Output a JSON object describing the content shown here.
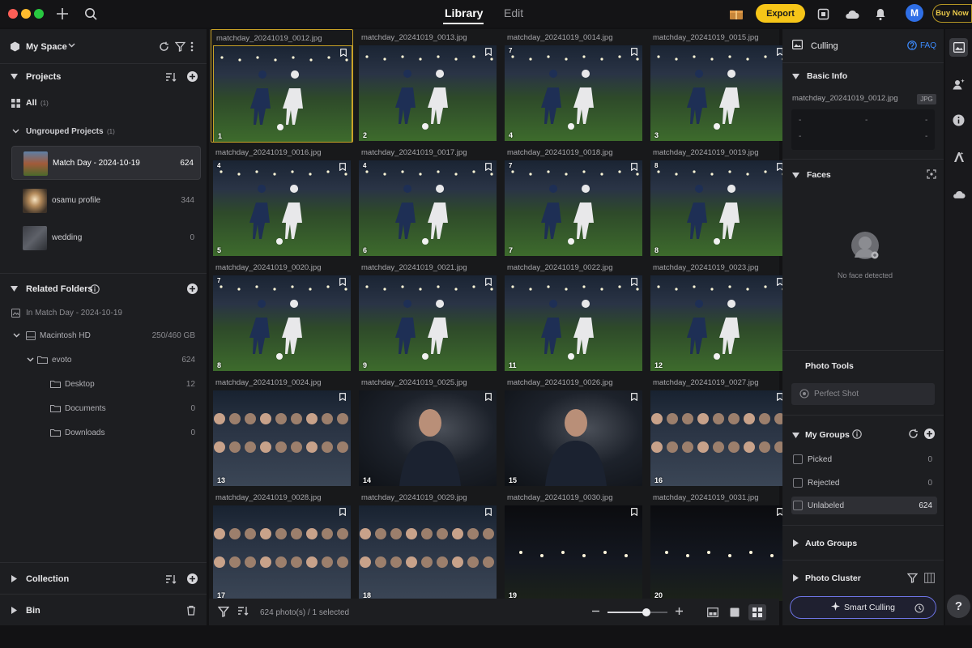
{
  "title_bar": {
    "tabs": [
      {
        "label": "Library",
        "active": true
      },
      {
        "label": "Edit",
        "active": false
      }
    ],
    "export_label": "Export",
    "avatar_initial": "M",
    "buy_label": "Buy Now",
    "accent_yellow": "#f6c518"
  },
  "left_panel": {
    "space_title": "My Space",
    "projects_header": "Projects",
    "all_label": "All",
    "all_count": "(1)",
    "ungrouped_label": "Ungrouped Projects",
    "ungrouped_count": "(1)",
    "projects": [
      {
        "name": "Match Day - 2024-10-19",
        "count": "624",
        "selected": true
      },
      {
        "name": "osamu profile",
        "count": "344",
        "selected": false
      },
      {
        "name": "wedding",
        "count": "0",
        "selected": false
      }
    ],
    "related_folders_header": "Related Folders",
    "in_project_label": "In Match Day - 2024-10-19",
    "drive": {
      "name": "Macintosh HD",
      "usage": "250/460 GB"
    },
    "folders": [
      {
        "name": "evoto",
        "count": "624"
      },
      {
        "name": "Desktop",
        "count": "12"
      },
      {
        "name": "Documents",
        "count": "0"
      },
      {
        "name": "Downloads",
        "count": "0"
      }
    ],
    "collection_label": "Collection",
    "bin_label": "Bin"
  },
  "grid": {
    "photos": [
      {
        "file": "matchday_20241019_0012.jpg",
        "number": "1",
        "rating": "",
        "scene": "stadium"
      },
      {
        "file": "matchday_20241019_0013.jpg",
        "number": "2",
        "rating": "",
        "scene": "stadium"
      },
      {
        "file": "matchday_20241019_0014.jpg",
        "number": "4",
        "rating": "7",
        "scene": "stadium"
      },
      {
        "file": "matchday_20241019_0015.jpg",
        "number": "3",
        "rating": "",
        "scene": "stadium"
      },
      {
        "file": "matchday_20241019_0016.jpg",
        "number": "5",
        "rating": "4",
        "scene": "stadium"
      },
      {
        "file": "matchday_20241019_0017.jpg",
        "number": "6",
        "rating": "4",
        "scene": "stadium"
      },
      {
        "file": "matchday_20241019_0018.jpg",
        "number": "7",
        "rating": "7",
        "scene": "stadium"
      },
      {
        "file": "matchday_20241019_0019.jpg",
        "number": "8",
        "rating": "8",
        "scene": "stadium"
      },
      {
        "file": "matchday_20241019_0020.jpg",
        "number": "8",
        "rating": "7",
        "scene": "stadium"
      },
      {
        "file": "matchday_20241019_0021.jpg",
        "number": "9",
        "rating": "",
        "scene": "stadium"
      },
      {
        "file": "matchday_20241019_0022.jpg",
        "number": "11",
        "rating": "",
        "scene": "stadium"
      },
      {
        "file": "matchday_20241019_0023.jpg",
        "number": "12",
        "rating": "",
        "scene": "stadium"
      },
      {
        "file": "matchday_20241019_0024.jpg",
        "number": "13",
        "rating": "",
        "scene": "crowd"
      },
      {
        "file": "matchday_20241019_0025.jpg",
        "number": "14",
        "rating": "",
        "scene": "portrait"
      },
      {
        "file": "matchday_20241019_0026.jpg",
        "number": "15",
        "rating": "",
        "scene": "portrait"
      },
      {
        "file": "matchday_20241019_0027.jpg",
        "number": "16",
        "rating": "",
        "scene": "crowd"
      },
      {
        "file": "matchday_20241019_0028.jpg",
        "number": "17",
        "rating": "",
        "scene": "crowd"
      },
      {
        "file": "matchday_20241019_0029.jpg",
        "number": "18",
        "rating": "",
        "scene": "crowd"
      },
      {
        "file": "matchday_20241019_0030.jpg",
        "number": "19",
        "rating": "",
        "scene": "dark"
      },
      {
        "file": "matchday_20241019_0031.jpg",
        "number": "20",
        "rating": "",
        "scene": "dark"
      }
    ],
    "selected_index": 0,
    "footer_text": "624 photo(s) / 1 selected",
    "zoom_fraction": 0.65
  },
  "right_panel": {
    "culling_title": "Culling",
    "faq_label": "FAQ",
    "basic_info_header": "Basic Info",
    "file_name": "matchday_20241019_0012.jpg",
    "file_type": "JPG",
    "info_dash": "-",
    "faces_header": "Faces",
    "no_face_text": "No face detected",
    "photo_tools_header": "Photo Tools",
    "perfect_shot_label": "Perfect Shot",
    "my_groups_header": "My Groups",
    "groups": [
      {
        "label": "Picked",
        "count": "0"
      },
      {
        "label": "Rejected",
        "count": "0"
      },
      {
        "label": "Unlabeled",
        "count": "624"
      }
    ],
    "auto_groups_header": "Auto Groups",
    "photo_cluster_header": "Photo Cluster",
    "smart_culling_label": "Smart Culling",
    "faq_color": "#3d8bfd"
  },
  "toolstrip": {
    "help_label": "?"
  }
}
